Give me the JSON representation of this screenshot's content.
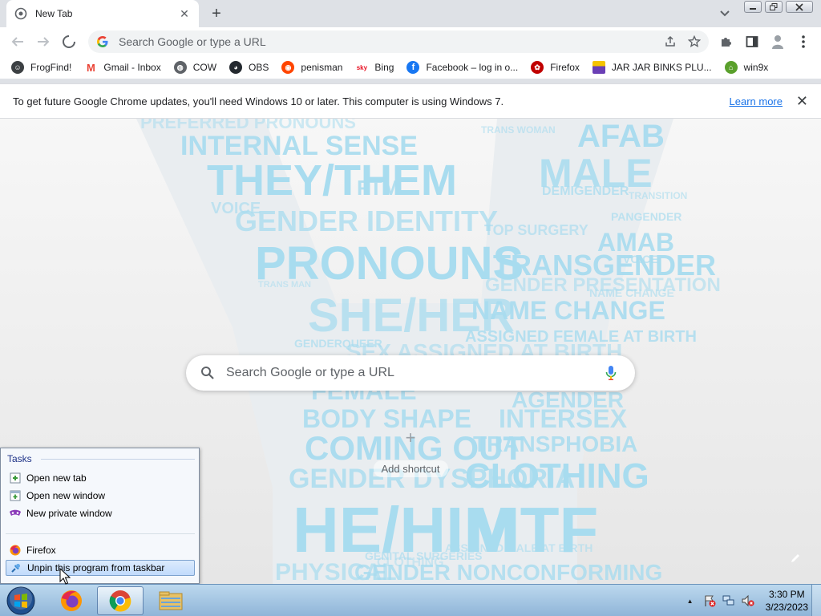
{
  "browser": {
    "tab": {
      "title": "New Tab",
      "close_label": "✕"
    },
    "new_tab_label": "+",
    "omnibox": {
      "placeholder": "Search Google or type a URL"
    },
    "bookmarks": [
      {
        "label": "FrogFind!",
        "icon": "frog-icon",
        "color": "#3c4043"
      },
      {
        "label": "Gmail - Inbox",
        "icon": "gmail-icon",
        "color": "#ea4335"
      },
      {
        "label": "COW",
        "icon": "globe-icon",
        "color": "#5f6368"
      },
      {
        "label": "OBS",
        "icon": "github-icon",
        "color": "#24292f"
      },
      {
        "label": "penisman",
        "icon": "reddit-icon",
        "color": "#ff4500"
      },
      {
        "label": "Bing",
        "icon": "bing-icon",
        "color": "#e81123"
      },
      {
        "label": "Facebook – log in o...",
        "icon": "facebook-icon",
        "color": "#1877f2"
      },
      {
        "label": "Firefox",
        "icon": "firefox-red-icon",
        "color": "#c00000"
      },
      {
        "label": "JAR JAR BINKS PLU...",
        "icon": "bag-icon",
        "color": "#6a3fb5"
      },
      {
        "label": "win9x",
        "icon": "win9x-icon",
        "color": "#5aa02c"
      }
    ],
    "infobar": {
      "message": "To get future Google Chrome updates, you'll need Windows 10 or later. This computer is using Windows 7.",
      "link": "Learn more",
      "close": "✕"
    }
  },
  "ntp": {
    "search_placeholder": "Search Google or type a URL",
    "shortcut_label": "Add shortcut",
    "shortcut_plus": "+"
  },
  "background_words": [
    "PREFERRED PRONOUNS",
    "INTERNAL SENSE",
    "THEY/THEM",
    "FTM",
    "GENDER IDENTITY",
    "PRONOUNS",
    "SHE/HER",
    "TRANSGENDER",
    "AFAB",
    "MALE",
    "AMAB",
    "NAME CHANGE",
    "GENDER PRESENTATION",
    "ASSIGNED FEMALE AT BIRTH",
    "SEX ASSIGNED AT BIRTH",
    "FEMALE",
    "BODY SHAPE",
    "COMING OUT",
    "CLOTHING",
    "TRANSPHOBIA",
    "INTERSEX",
    "AGENDER",
    "GENDER DYSPHORIA",
    "HE/HIM",
    "MTF",
    "PHYSICAL",
    "GENDER NONCONFORMING",
    "TOP SURGERY",
    "DEMIGENDER",
    "PANGENDER",
    "VOICE",
    "TRANS WOMAN",
    "TRANS MAN",
    "GENDERQUEER",
    "ASSIGNED MALE AT BIRTH",
    "GENITAL SURGERIES",
    "CLOTHING",
    "VOICE",
    "TRANSITION",
    "NAME CHANGE"
  ],
  "jumplist": {
    "header": "Tasks",
    "tasks": [
      {
        "label": "Open new tab",
        "icon": "new-tab-icon"
      },
      {
        "label": "Open new window",
        "icon": "new-window-icon"
      },
      {
        "label": "New private window",
        "icon": "private-window-icon"
      }
    ],
    "pinned": [
      {
        "label": "Firefox",
        "icon": "firefox-icon"
      },
      {
        "label": "Unpin this program from taskbar",
        "icon": "unpin-icon",
        "selected": true
      }
    ]
  },
  "taskbar": {
    "apps": [
      "firefox-icon",
      "chrome-icon",
      "explorer-folder-icon"
    ],
    "active_app": "chrome-icon",
    "clock": {
      "time": "3:30 PM",
      "date": "3/23/2023"
    },
    "tray_arrow": "▲"
  }
}
